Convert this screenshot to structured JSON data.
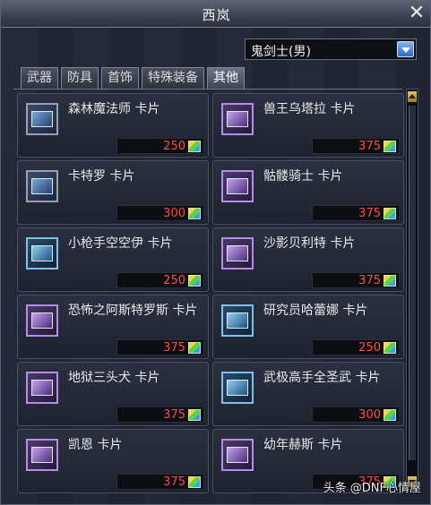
{
  "window": {
    "title": "西岚"
  },
  "job_select": {
    "value": "鬼剑士(男)"
  },
  "tabs": [
    {
      "label": "武器",
      "active": false
    },
    {
      "label": "防具",
      "active": false
    },
    {
      "label": "首饰",
      "active": false
    },
    {
      "label": "特殊装备",
      "active": false
    },
    {
      "label": "其他",
      "active": true
    }
  ],
  "cards": [
    {
      "name": "森林魔法师 卡片",
      "price": "250",
      "frame": "default"
    },
    {
      "name": "兽王乌塔拉 卡片",
      "price": "375",
      "frame": "purple"
    },
    {
      "name": "卡特罗 卡片",
      "price": "300",
      "frame": "default"
    },
    {
      "name": "骷髅骑士 卡片",
      "price": "375",
      "frame": "purple"
    },
    {
      "name": "小枪手空空伊 卡片",
      "price": "250",
      "frame": "blue"
    },
    {
      "name": "沙影贝利特 卡片",
      "price": "375",
      "frame": "purple"
    },
    {
      "name": "恐怖之阿斯特罗斯 卡片",
      "price": "375",
      "frame": "purple"
    },
    {
      "name": "研究员哈蕾娜 卡片",
      "price": "250",
      "frame": "blue"
    },
    {
      "name": "地狱三头犬 卡片",
      "price": "375",
      "frame": "purple"
    },
    {
      "name": "武极高手全圣武 卡片",
      "price": "300",
      "frame": "blue"
    },
    {
      "name": "凯恩 卡片",
      "price": "375",
      "frame": "purple"
    },
    {
      "name": "幼年赫斯 卡片",
      "price": "375",
      "frame": "purple"
    }
  ],
  "watermark": "头条 @DNF心情屋",
  "colors": {
    "price": "#ff4a4a",
    "accent": "#2e6cc4"
  },
  "icons": {
    "close": "close-icon",
    "currency": "cera-icon",
    "dropdown": "chevron-down-icon"
  }
}
